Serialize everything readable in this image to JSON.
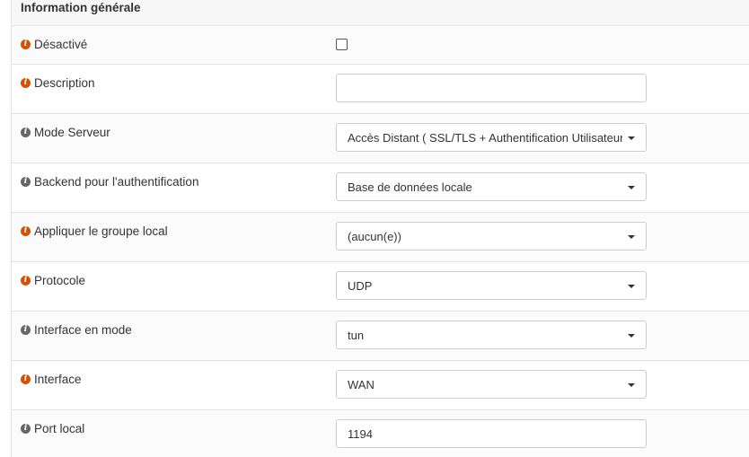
{
  "section": {
    "title": "Information générale"
  },
  "fields": [
    {
      "label": "Désactivé",
      "icon": "info-icon",
      "icon_color": "#d94f00",
      "type": "checkbox",
      "checked": false
    },
    {
      "label": "Description",
      "icon": "info-icon",
      "icon_color": "#d94f00",
      "type": "text",
      "value": ""
    },
    {
      "label": "Mode Serveur",
      "icon": "info-icon",
      "icon_color": "#666666",
      "type": "select",
      "value": "Accès Distant ( SSL/TLS + Authentification Utilisateur )"
    },
    {
      "label": "Backend pour l'authentification",
      "icon": "info-icon",
      "icon_color": "#666666",
      "type": "select",
      "value": "Base de données locale"
    },
    {
      "label": "Appliquer le groupe local",
      "icon": "info-icon",
      "icon_color": "#d94f00",
      "type": "select",
      "value": "(aucun(e))"
    },
    {
      "label": "Protocole",
      "icon": "info-icon",
      "icon_color": "#d94f00",
      "type": "select",
      "value": "UDP"
    },
    {
      "label": "Interface en mode",
      "icon": "info-icon",
      "icon_color": "#666666",
      "type": "select",
      "value": "tun"
    },
    {
      "label": "Interface",
      "icon": "info-icon",
      "icon_color": "#d94f00",
      "type": "select",
      "value": "WAN"
    },
    {
      "label": "Port local",
      "icon": "info-icon",
      "icon_color": "#666666",
      "type": "text",
      "value": "1194"
    }
  ]
}
